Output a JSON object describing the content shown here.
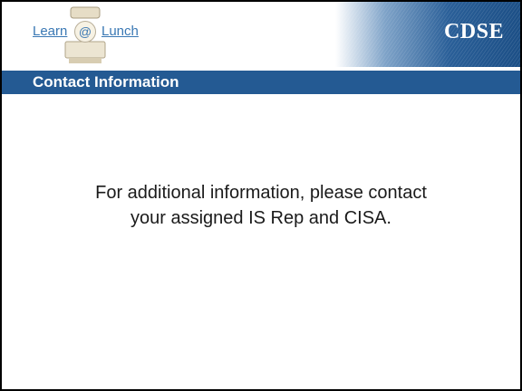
{
  "header": {
    "logo_learn": "Learn",
    "logo_at": "@",
    "logo_lunch": "Lunch",
    "brand": "CDSE"
  },
  "title_bar": {
    "title": "Contact Information"
  },
  "content": {
    "lines": [
      "For additional information, please contact",
      "your assigned IS Rep and CISA."
    ]
  },
  "colors": {
    "banner_dark": "#1c4f86",
    "banner_light": "#ffffff",
    "title_bar": "#245a93",
    "link_blue": "#3a78b4",
    "border": "#000000"
  },
  "icons": {
    "logo_mascot": "lunch-tray-figure-icon"
  }
}
